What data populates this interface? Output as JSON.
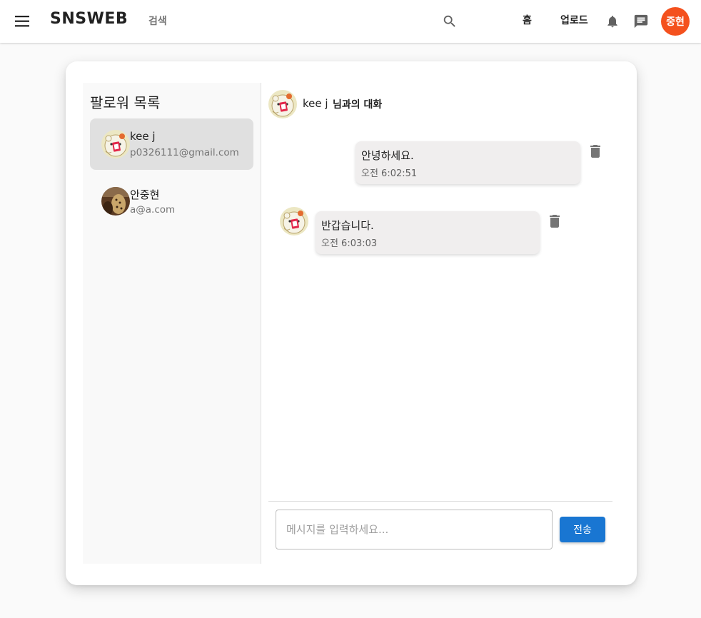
{
  "appbar": {
    "brand": "SNSWEB",
    "search_label": "검색",
    "nav_home": "홈",
    "nav_upload": "업로드",
    "user_initials": "중현",
    "icons": [
      "menu-icon",
      "search-icon",
      "bell-icon",
      "chat-icon"
    ]
  },
  "sidebar": {
    "title": "팔로워 목록",
    "contacts": [
      {
        "name": "kee j",
        "email": "p0326111@gmail.com",
        "selected": true,
        "avatar": "hamster-avatar"
      },
      {
        "name": "안중현",
        "email": "a@a.com",
        "selected": false,
        "avatar": "photo-avatar"
      }
    ]
  },
  "chat": {
    "partner_name": "kee j",
    "header_suffix": "님과의 대화",
    "messages": [
      {
        "text": "안녕하세요.",
        "time": "오전 6:02:51",
        "side": "right"
      },
      {
        "text": "반갑습니다.",
        "time": "오전 6:03:03",
        "side": "left"
      }
    ],
    "input_placeholder": "메시지를 입력하세요...",
    "input_value": "",
    "send_label": "전송"
  },
  "colors": {
    "accent": "#1976d2",
    "user_avatar_bg": "#f4511e",
    "bubble_bg": "#f0eeee",
    "selected_contact_bg": "#e0e0e0"
  }
}
